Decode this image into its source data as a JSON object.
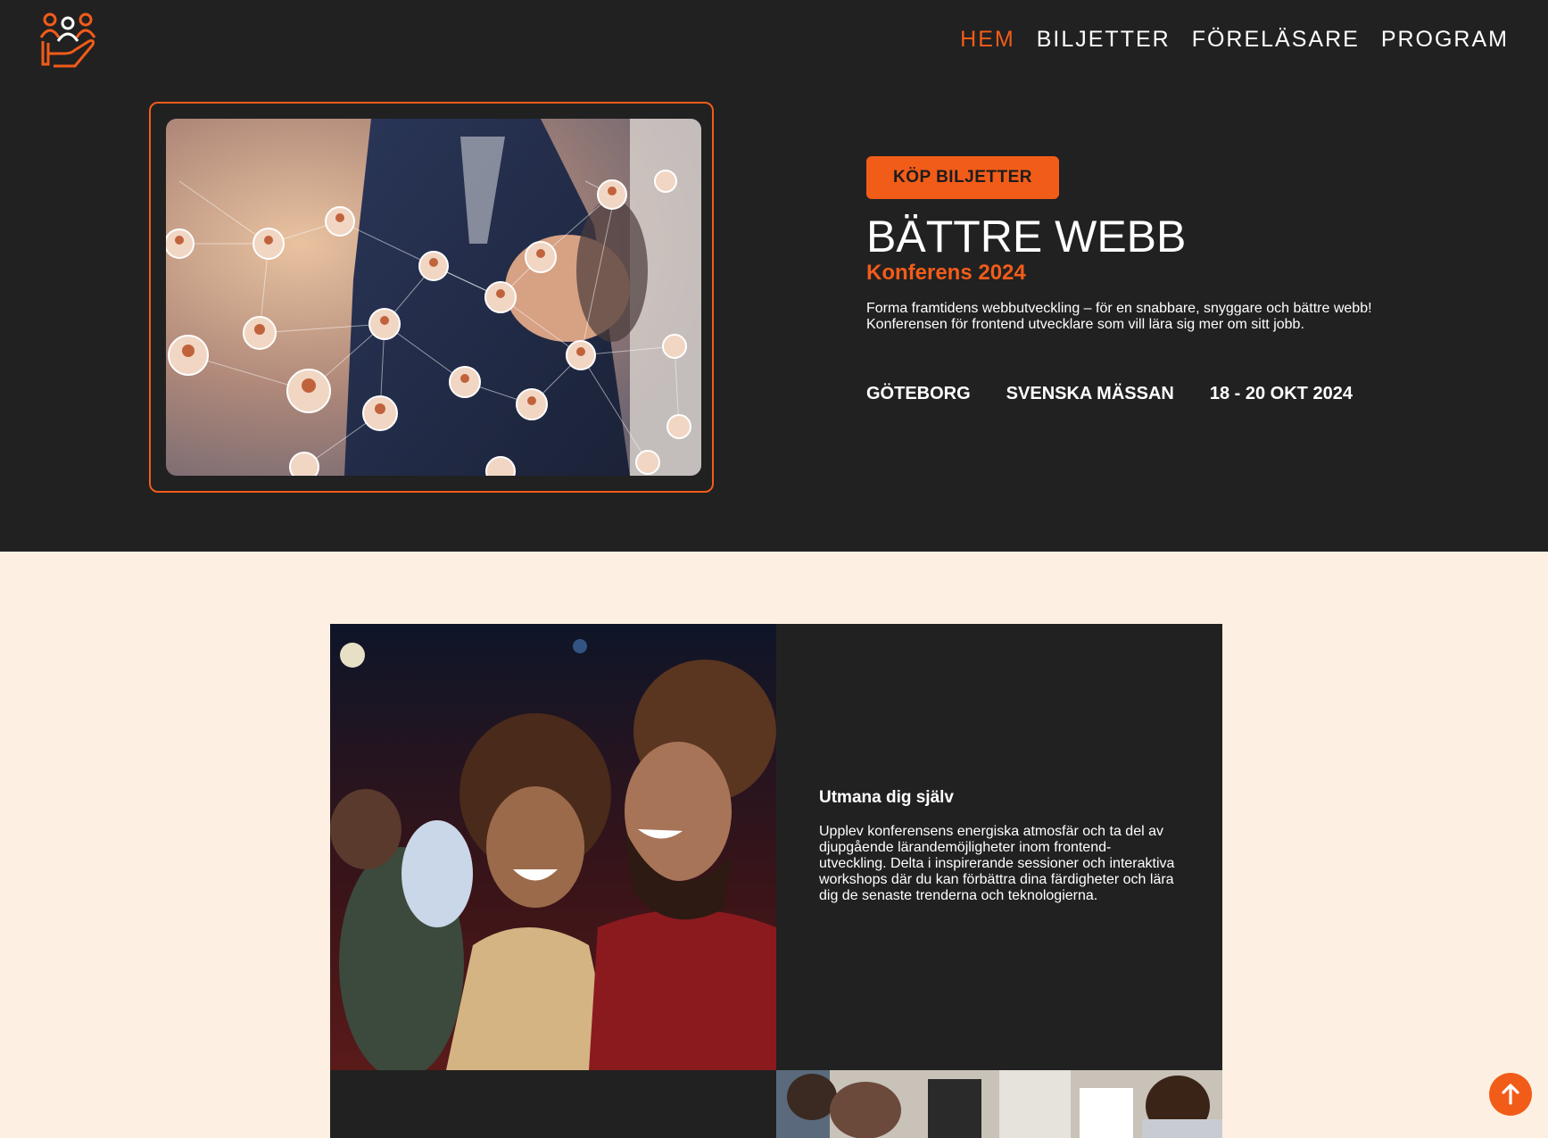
{
  "nav": {
    "items": [
      {
        "label": "HEM",
        "active": true
      },
      {
        "label": "BILJETTER",
        "active": false
      },
      {
        "label": "FÖRELÄSARE",
        "active": false
      },
      {
        "label": "PROGRAM",
        "active": false
      }
    ]
  },
  "logo": {
    "icon": "people-hand-icon"
  },
  "hero": {
    "cta_label": "KÖP BILJETTER",
    "title": "BÄTTRE WEBB",
    "subtitle": "Konferens 2024",
    "description_line1": "Forma framtidens webbutveckling – för en snabbare, snyggare och bättre webb!",
    "description_line2": "Konferensen för frontend utvecklare som vill lära sig mer om sitt jobb.",
    "city": "GÖTEBORG",
    "venue": "SVENSKA MÄSSAN",
    "dates": "18 - 20 OKT 2024"
  },
  "feature": {
    "heading": "Utmana dig själv",
    "body": "Upplev konferensens energiska atmosfär och ta del av djupgående lärandemöjligheter inom frontend-utveckling. Delta i inspirerande sessioner och interaktiva workshops där du kan förbättra dina färdigheter och lära dig de senaste trenderna och teknologierna."
  },
  "scroll_top": {
    "icon": "arrow-up-icon"
  },
  "colors": {
    "accent": "#f25c19",
    "dark": "#212121",
    "cream": "#fdf0e2",
    "text": "#ffffff"
  }
}
